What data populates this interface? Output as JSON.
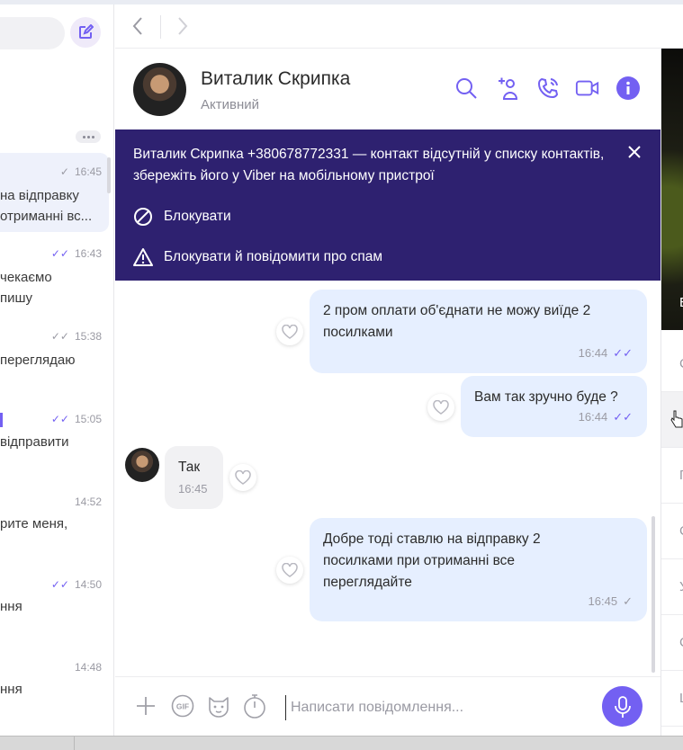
{
  "nav": {
    "back_icon": "chevron-left-icon",
    "forward_icon": "chevron-right-icon"
  },
  "sidebar": {
    "chats": [
      {
        "time": "16:45",
        "check": "single",
        "line1": "на відправку",
        "line2": "отриманні вс...",
        "selected": true
      },
      {
        "time": "16:43",
        "check": "double-read",
        "line1": "чекаємо",
        "line2": "пишу"
      },
      {
        "time": "15:38",
        "check": "double",
        "line1": "переглядаю",
        "line2": ""
      },
      {
        "time": "15:05",
        "check": "double-read",
        "line1": "",
        "line2": "відправити"
      },
      {
        "time": "14:52",
        "check": "",
        "line1": "рите меня,",
        "line2": ""
      },
      {
        "time": "14:50",
        "check": "double-read",
        "line1": "ння",
        "line2": ""
      },
      {
        "time": "14:48",
        "check": "",
        "line1": "ння",
        "line2": ""
      }
    ]
  },
  "header": {
    "name": "Виталик Скрипка",
    "status": "Активний",
    "icons": [
      "search-icon",
      "add-participant-icon",
      "voice-call-icon",
      "video-call-icon",
      "info-icon"
    ]
  },
  "banner": {
    "text": "Виталик Скрипка +380678772331 — контакт відсутній у списку контактів, збережіть його у Viber на мобільному пристрої",
    "block_label": "Блокувати",
    "block_report_label": "Блокувати й повідомити про спам"
  },
  "messages": [
    {
      "dir": "out",
      "text_lines": [
        "2 пром оплати об'єднати не можу виїде 2",
        "посилками"
      ],
      "time": "16:44",
      "check": "double-read"
    },
    {
      "dir": "out",
      "text_lines": [
        "Вам так зручно буде ?"
      ],
      "time": "16:44",
      "check": "double-read"
    },
    {
      "dir": "in",
      "text_lines": [
        "Так"
      ],
      "time": "16:45",
      "check": ""
    },
    {
      "dir": "out",
      "text_lines": [
        "Добре тоді ставлю на відправку 2",
        "посилками при отриманні все",
        "переглядайте"
      ],
      "time": "16:45",
      "check": "single"
    }
  ],
  "right_panel": {
    "image_label": "В",
    "rows": [
      "С",
      "",
      "П",
      "С",
      "У",
      "С",
      "Ц"
    ]
  },
  "composer": {
    "placeholder": "Написати повідомлення..."
  },
  "colors": {
    "accent": "#7360f2",
    "banner_bg": "#2e2170",
    "bubble_out": "#e6efff",
    "bubble_in": "#f1f1f3"
  }
}
